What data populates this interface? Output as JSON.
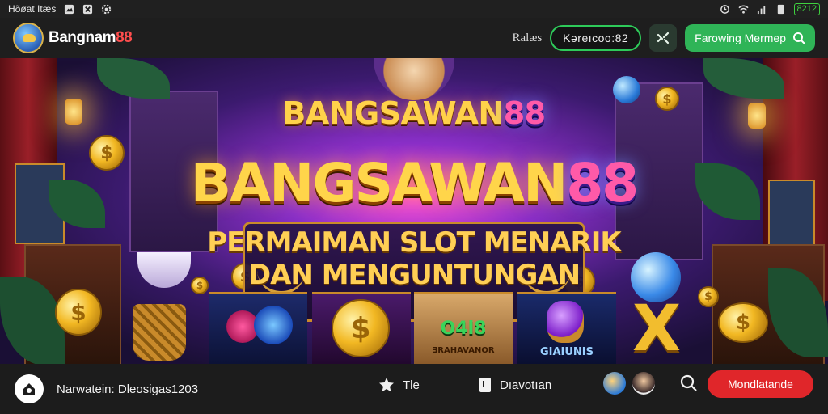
{
  "status_bar": {
    "left_text": "Hðøat Itæs",
    "battery": "8212"
  },
  "header": {
    "brand_prefix": "Bangnam",
    "brand_number": "88",
    "label": "Ralæs",
    "code": "Kəreıcoo:82",
    "green_button": "Farowing Mermep"
  },
  "hero": {
    "title_small_text": "BANGSAWAN",
    "title_small_number": "88",
    "title_big_text": "BANGSAWAN",
    "title_big_number": "88",
    "subtitle_line1": "PERMAIMAN SLOT MENARIK",
    "subtitle_line2": "DAN MENGUNTUNGAN",
    "tile_text_1": "O4l8",
    "tile_text_2": "ƎRAHAVANOR",
    "tile_text_3": "GIAIUNIS"
  },
  "bottom_bar": {
    "user_text": "Narwatein: Dleosigas1203",
    "nav1_label": "Tle",
    "nav2_label": "Dıavotıan",
    "red_button": "Mondlatande"
  },
  "colors": {
    "accent_green": "#2fb457",
    "accent_red": "#e0262a",
    "title_gold": "#ffd54a"
  },
  "icons": {
    "header_shuffle": "shuffle-icon",
    "header_search": "search-icon",
    "bottom_home": "home-icon",
    "bottom_star": "star-icon",
    "bottom_doc": "document-icon",
    "bottom_search": "search-icon"
  }
}
